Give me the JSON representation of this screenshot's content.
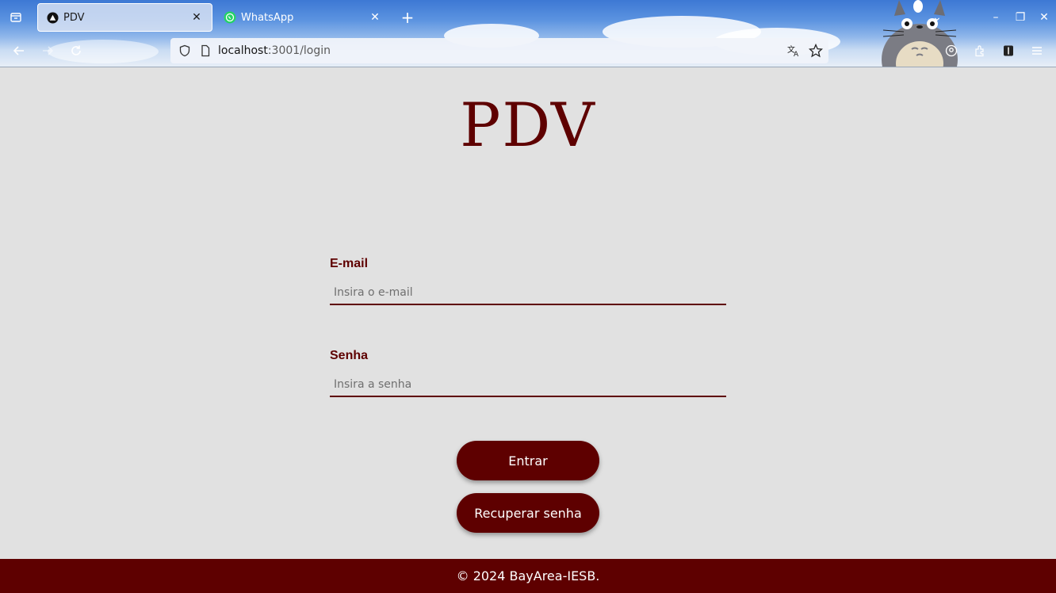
{
  "browser": {
    "tabs": [
      {
        "title": "PDV",
        "active": true,
        "icon": "nextjs-icon"
      },
      {
        "title": "WhatsApp",
        "active": false,
        "icon": "whatsapp-icon"
      }
    ],
    "url": {
      "host": "localhost",
      "path": ":3001/login"
    }
  },
  "page": {
    "logo": "PDV",
    "email": {
      "label": "E-mail",
      "placeholder": "Insira o e-mail"
    },
    "password": {
      "label": "Senha",
      "placeholder": "Insira a senha"
    },
    "login_button": "Entrar",
    "recover_button": "Recuperar senha"
  },
  "footer": {
    "text": "© 2024 BayArea-IESB."
  },
  "colors": {
    "brand": "#5e0000",
    "page_bg": "#e1e1e1"
  }
}
